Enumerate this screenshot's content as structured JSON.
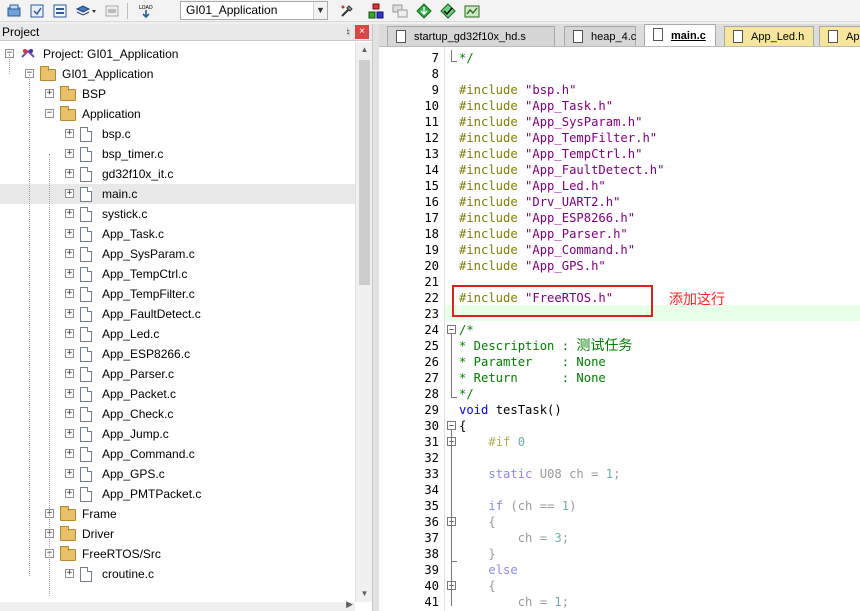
{
  "toolbar": {
    "target_name": "GI01_Application",
    "icons": [
      "options-icon",
      "translate-icon",
      "batch-build-icon",
      "build-dropdown-icon",
      "stop-build-icon",
      "download-icon",
      "target-options-icon",
      "manage-components-icon",
      "multi-project-icon",
      "pack-installer-icon",
      "select-packs-icon",
      "event-recorder-icon"
    ]
  },
  "project_panel": {
    "title": "Project",
    "tree": [
      {
        "label": "Project: GI01_Application",
        "type": "project",
        "level": 0,
        "expander": "-"
      },
      {
        "label": "GI01_Application",
        "type": "target",
        "level": 1,
        "expander": "-"
      },
      {
        "label": "BSP",
        "type": "folder",
        "level": 2,
        "expander": "+"
      },
      {
        "label": "Application",
        "type": "folder",
        "level": 2,
        "expander": "-"
      },
      {
        "label": "bsp.c",
        "type": "file",
        "level": 3,
        "expander": "+"
      },
      {
        "label": "bsp_timer.c",
        "type": "file",
        "level": 3,
        "expander": "+"
      },
      {
        "label": "gd32f10x_it.c",
        "type": "file",
        "level": 3,
        "expander": "+"
      },
      {
        "label": "main.c",
        "type": "file",
        "level": 3,
        "expander": "+",
        "selected": true
      },
      {
        "label": "systick.c",
        "type": "file",
        "level": 3,
        "expander": "+"
      },
      {
        "label": "App_Task.c",
        "type": "file",
        "level": 3,
        "expander": "+"
      },
      {
        "label": "App_SysParam.c",
        "type": "file",
        "level": 3,
        "expander": "+"
      },
      {
        "label": "App_TempCtrl.c",
        "type": "file",
        "level": 3,
        "expander": "+"
      },
      {
        "label": "App_TempFilter.c",
        "type": "file",
        "level": 3,
        "expander": "+"
      },
      {
        "label": "App_FaultDetect.c",
        "type": "file",
        "level": 3,
        "expander": "+"
      },
      {
        "label": "App_Led.c",
        "type": "file",
        "level": 3,
        "expander": "+"
      },
      {
        "label": "App_ESP8266.c",
        "type": "file",
        "level": 3,
        "expander": "+"
      },
      {
        "label": "App_Parser.c",
        "type": "file",
        "level": 3,
        "expander": "+"
      },
      {
        "label": "App_Packet.c",
        "type": "file",
        "level": 3,
        "expander": "+"
      },
      {
        "label": "App_Check.c",
        "type": "file",
        "level": 3,
        "expander": "+"
      },
      {
        "label": "App_Jump.c",
        "type": "file",
        "level": 3,
        "expander": "+"
      },
      {
        "label": "App_Command.c",
        "type": "file",
        "level": 3,
        "expander": "+"
      },
      {
        "label": "App_GPS.c",
        "type": "file",
        "level": 3,
        "expander": "+"
      },
      {
        "label": "App_PMTPacket.c",
        "type": "file",
        "level": 3,
        "expander": "+"
      },
      {
        "label": "Frame",
        "type": "folder",
        "level": 2,
        "expander": "+"
      },
      {
        "label": "Driver",
        "type": "folder",
        "level": 2,
        "expander": "+"
      },
      {
        "label": "FreeRTOS/Src",
        "type": "folder",
        "level": 2,
        "expander": "-"
      },
      {
        "label": "croutine.c",
        "type": "file",
        "level": 3,
        "expander": "+"
      }
    ]
  },
  "editor_tabs": [
    {
      "label": "startup_gd32f10x_hd.s",
      "active": false,
      "modified_color": false
    },
    {
      "label": "heap_4.c",
      "active": false,
      "modified_color": false
    },
    {
      "label": "main.c",
      "active": true,
      "modified_color": false
    },
    {
      "label": "App_Led.h",
      "active": false,
      "modified_color": true
    },
    {
      "label": "Ap",
      "active": false,
      "modified_color": true
    }
  ],
  "code": {
    "lines": [
      {
        "n": "7",
        "text": "*/"
      },
      {
        "n": "8",
        "text": ""
      },
      {
        "n": "9",
        "text": "#include \"bsp.h\""
      },
      {
        "n": "10",
        "text": "#include \"App_Task.h\""
      },
      {
        "n": "11",
        "text": "#include \"App_SysParam.h\""
      },
      {
        "n": "12",
        "text": "#include \"App_TempFilter.h\""
      },
      {
        "n": "13",
        "text": "#include \"App_TempCtrl.h\""
      },
      {
        "n": "14",
        "text": "#include \"App_FaultDetect.h\""
      },
      {
        "n": "15",
        "text": "#include \"App_Led.h\""
      },
      {
        "n": "16",
        "text": "#include \"Drv_UART2.h\""
      },
      {
        "n": "17",
        "text": "#include \"App_ESP8266.h\""
      },
      {
        "n": "18",
        "text": "#include \"App_Parser.h\""
      },
      {
        "n": "19",
        "text": "#include \"App_Command.h\""
      },
      {
        "n": "20",
        "text": "#include \"App_GPS.h\""
      },
      {
        "n": "21",
        "text": ""
      },
      {
        "n": "22",
        "text": "#include \"FreeRTOS.h\""
      },
      {
        "n": "23",
        "text": ""
      },
      {
        "n": "24",
        "text": "/*"
      },
      {
        "n": "25",
        "text": "* Description : 测试任务"
      },
      {
        "n": "26",
        "text": "* Paramter    : None"
      },
      {
        "n": "27",
        "text": "* Return      : None"
      },
      {
        "n": "28",
        "text": "*/"
      },
      {
        "n": "29",
        "text": "void tesTask()"
      },
      {
        "n": "30",
        "text": "{"
      },
      {
        "n": "31",
        "text": "    #if 0"
      },
      {
        "n": "32",
        "text": ""
      },
      {
        "n": "33",
        "text": "    static U08 ch = 1;"
      },
      {
        "n": "34",
        "text": ""
      },
      {
        "n": "35",
        "text": "    if (ch == 1)"
      },
      {
        "n": "36",
        "text": "    {"
      },
      {
        "n": "37",
        "text": "        ch = 3;"
      },
      {
        "n": "38",
        "text": "    }"
      },
      {
        "n": "39",
        "text": "    else"
      },
      {
        "n": "40",
        "text": "    {"
      },
      {
        "n": "41",
        "text": "        ch = 1;"
      }
    ]
  },
  "annotation": {
    "text": "添加这行",
    "color": "#ff2020"
  }
}
